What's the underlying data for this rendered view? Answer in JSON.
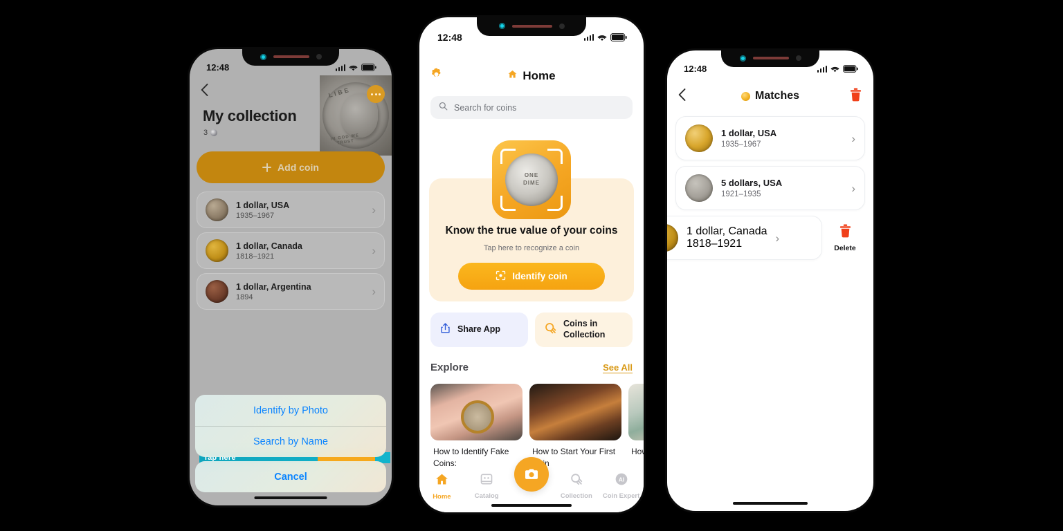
{
  "left_phone": {
    "status": {
      "time": "12:48",
      "signal_icon": "cellular-bars-icon",
      "wifi_icon": "wifi-icon",
      "battery_icon": "battery-icon"
    },
    "back_icon": "chevron-left-icon",
    "more_icon": "more-options-icon",
    "title": "My collection",
    "count": "3",
    "count_icon": "coin-icon",
    "add_button": {
      "label": "Add coin",
      "icon": "plus-icon"
    },
    "coins": [
      {
        "name": "1 dollar, USA",
        "years": "1935–1967",
        "avatar": "coin-silver"
      },
      {
        "name": "1 dollar, Canada",
        "years": "1818–1921",
        "avatar": "coin-gold"
      },
      {
        "name": "1 dollar, Argentina",
        "years": "1894",
        "avatar": "coin-copper"
      }
    ],
    "coach_mark": "Tap here",
    "action_sheet": {
      "options": [
        "Identify by Photo",
        "Search by Name"
      ],
      "cancel": "Cancel"
    }
  },
  "mid_phone": {
    "status": {
      "time": "12:48",
      "signal_icon": "cellular-bars-icon",
      "wifi_icon": "wifi-icon",
      "battery_icon": "battery-icon"
    },
    "header": {
      "settings_icon": "gear-icon",
      "title": "Home",
      "title_icon": "home-icon"
    },
    "search": {
      "placeholder": "Search for coins",
      "icon": "search-icon"
    },
    "hero": {
      "scanner_icon": "scan-frame-icon",
      "coin_line1": "ONE",
      "coin_line2": "DIME",
      "title": "Know the true value of your coins",
      "subtitle": "Tap here to recognize a coin",
      "button": {
        "label": "Identify coin",
        "icon": "scan-target-icon"
      }
    },
    "quick_actions": [
      {
        "label": "Share App",
        "icon": "share-icon"
      },
      {
        "label": "Coins in Collection",
        "icon": "coin-stack-icon"
      }
    ],
    "explore": {
      "label": "Explore",
      "see_all": "See All"
    },
    "cards": [
      {
        "caption": "How to Identify Fake Coins:",
        "thumb": "hand-with-magnifier"
      },
      {
        "caption": "How to Start Your First Coin",
        "thumb": "coin-stacks"
      },
      {
        "caption": "How to v",
        "thumb": "banknotes"
      }
    ],
    "tabs": [
      {
        "label": "Home",
        "icon": "home-icon",
        "active": true
      },
      {
        "label": "Catalog",
        "icon": "catalog-icon",
        "active": false
      },
      {
        "label": "",
        "icon": "camera-shutter-icon",
        "active": false
      },
      {
        "label": "Collection",
        "icon": "coin-stack-icon",
        "active": false
      },
      {
        "label": "Coin Expert",
        "icon": "ai-icon",
        "active": false
      }
    ]
  },
  "right_phone": {
    "status": {
      "time": "12:48",
      "signal_icon": "cellular-bars-icon",
      "wifi_icon": "wifi-icon",
      "battery_icon": "battery-icon"
    },
    "header": {
      "back_icon": "chevron-left-icon",
      "title": "Matches",
      "title_icon": "coin-icon",
      "trash_icon": "trash-icon"
    },
    "matches": [
      {
        "name": "1 dollar, USA",
        "years": "1935–1967",
        "avatar": "coin-goldlt"
      },
      {
        "name": "5 dollars, USA",
        "years": "1921–1935",
        "avatar": "coin-qtr"
      }
    ],
    "swiped_row": {
      "name": "1 dollar, Canada",
      "years": "1818–1921",
      "avatar": "coin-gold",
      "delete_label": "Delete",
      "delete_icon": "trash-icon"
    }
  },
  "colors": {
    "accent_orange": "#f5a623",
    "dimmed_orange": "#c3860f",
    "ios_blue": "#0a84ff",
    "delete_red": "#f0401a",
    "coach_teal": "#10aec6"
  }
}
